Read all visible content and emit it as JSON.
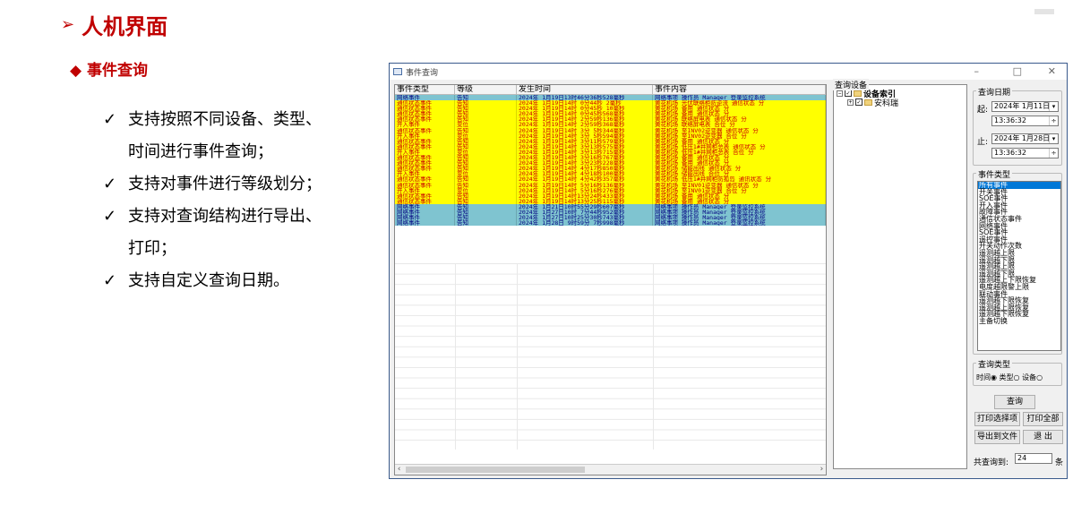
{
  "slide": {
    "title": "人机界面",
    "subtitle": "事件查询",
    "bullets": [
      {
        "check": "✓",
        "lines": [
          "支持按照不同设备、类型、",
          "时间进行事件查询；"
        ]
      },
      {
        "check": "✓",
        "lines": [
          "支持对事件进行等级划分；"
        ]
      },
      {
        "check": "✓",
        "lines": [
          "支持对查询结构进行导出、",
          "打印；"
        ]
      },
      {
        "check": "✓",
        "lines": [
          "支持自定义查询日期。"
        ]
      }
    ]
  },
  "window": {
    "title": "事件查询",
    "minimize": "–",
    "maximize": "□",
    "close": "✕"
  },
  "table": {
    "columns": [
      "事件类型",
      "等级",
      "发生时间",
      "事件内容"
    ],
    "rows": [
      {
        "type": "网络事件",
        "level": "告知",
        "time": "2024年 1月19日13时46分36秒528毫秒",
        "content": "网络事项 操作员 Manager 登录监控系统",
        "color": "c"
      },
      {
        "type": "通信状态事件",
        "level": "告知",
        "time": "2024年 1月19日14时 0分44秒  2毫秒",
        "content": "黄花机场 光伏联络柜防逆流 通信状态 分",
        "color": "y"
      },
      {
        "type": "通信状态事件",
        "level": "告知",
        "time": "2024年 1月19日14时 0分45秒 10毫秒",
        "content": "黄花机场 备用 通信状态 分",
        "color": "y"
      },
      {
        "type": "通信状态事件",
        "level": "告知",
        "time": "2024年 1月19日14时 0分45秒568毫秒",
        "content": "黄花机场 备用 通信状态 分",
        "color": "y"
      },
      {
        "type": "通信状态事件",
        "level": "告知",
        "time": "2024年 1月19日14时 2分59秒136毫秒",
        "content": "黄花机场 联络屏电表 通信状态 分",
        "color": "y"
      },
      {
        "type": "开入事件",
        "level": "变位",
        "time": "2024年 1月19日14时 2分59秒368毫秒",
        "content": "黄花机场 联络屏电表 合位 分",
        "color": "y"
      },
      {
        "type": "通信状态事件",
        "level": "告知",
        "time": "2024年 1月19日14时 3分 5秒344毫秒",
        "content": "黄花机场 至INV02逆变器 通信状态 分",
        "color": "y"
      },
      {
        "type": "开入事件",
        "level": "变位",
        "time": "2024年 1月19日14时 3分 5秒594毫秒",
        "content": "黄花机场 至INV02逆变器 合位 分",
        "color": "y"
      },
      {
        "type": "通信状态事件",
        "level": "告知",
        "time": "2024年 1月19日14时 3分11秒579毫秒",
        "content": "黄花机场 备用 通信状态 分",
        "color": "y"
      },
      {
        "type": "通信状态事件",
        "level": "告知",
        "time": "2024年 1月19日14时 3分13秒575毫秒",
        "content": "黄花机场 低压1#并网柜总表 通信状态 分",
        "color": "y"
      },
      {
        "type": "开入事件",
        "level": "变位",
        "time": "2024年 1月19日14时 3分13秒715毫秒",
        "content": "黄花机场 低压1#并网柜总表 合位 分",
        "color": "y"
      },
      {
        "type": "通信状态事件",
        "level": "告知",
        "time": "2024年 1月19日14时 3分16秒767毫秒",
        "content": "黄花机场 备用 通信状态 分",
        "color": "y"
      },
      {
        "type": "通信状态事件",
        "level": "告知",
        "time": "2024年 1月19日14时 3分23秒228毫秒",
        "content": "黄花机场 备用 通信状态 分",
        "color": "y"
      },
      {
        "type": "通信状态事件",
        "level": "告知",
        "time": "2024年 1月19日14时 4分17秒850毫秒",
        "content": "黄花机场 储能出线 通信状态 分",
        "color": "y"
      },
      {
        "type": "开入事件",
        "level": "变位",
        "time": "2024年 1月19日14时 4分18秒100毫秒",
        "content": "黄花机场 储能出线 合位 分",
        "color": "y"
      },
      {
        "type": "通信状态事件",
        "level": "告知",
        "time": "2024年 1月19日14时 4分42秒357毫秒",
        "content": "黄花机场 低压1#并网柜防孤岛 通讯状态 分",
        "color": "y"
      },
      {
        "type": "通信状态事件",
        "level": "告知",
        "time": "2024年 1月19日14时 5分16秒136毫秒",
        "content": "黄花机场 至INV01逆变器 通信状态 分",
        "color": "y"
      },
      {
        "type": "开入事件",
        "level": "变位",
        "time": "2024年 1月19日14时 5分16秒276毫秒",
        "content": "黄花机场 至INV01逆变器 合位 分",
        "color": "y"
      },
      {
        "type": "通信状态事件",
        "level": "告知",
        "time": "2024年 1月19日14时13分24秒433毫秒",
        "content": "黄花机场 备用 通信状态 分",
        "color": "y"
      },
      {
        "type": "通信状态事件",
        "level": "告知",
        "time": "2024年 1月19日14时13分25秒115毫秒",
        "content": "黄花机场 备用 通信状态 分",
        "color": "y"
      },
      {
        "type": "网络事件",
        "level": "告知",
        "time": "2024年 1月21日10时55分29秒607毫秒",
        "content": "网络事项 操作员 Manager 登录监控系统",
        "color": "c"
      },
      {
        "type": "网络事件",
        "level": "告知",
        "time": "2024年 1月27日10时 7分44秒952毫秒",
        "content": "网络事项 操作员 Manager 登录监控系统",
        "color": "c"
      },
      {
        "type": "网络事件",
        "level": "告知",
        "time": "2024年 1月27日10时25分30秒743毫秒",
        "content": "网络事项 操作员 Manager 登录监控系统",
        "color": "c"
      },
      {
        "type": "网络事件",
        "level": "告知",
        "time": "2024年 1月28日 9时59分 7秒998毫秒",
        "content": "网络事项 操作员 Manager 登录监控系统",
        "color": "c"
      }
    ],
    "scroll_left": "‹",
    "scroll_right": "›"
  },
  "tree": {
    "label": "查询设备",
    "root": "设备索引",
    "child": "安科瑞",
    "expand_root": "−",
    "expand_child": "+",
    "check_mark": "✓"
  },
  "date": {
    "label": "查询日期",
    "start_label": "起:",
    "start_date": "2024年 1月11日",
    "start_time": "13:36:32",
    "end_label": "止:",
    "end_date": "2024年 1月28日",
    "end_time": "13:36:32",
    "dd": "▾",
    "spin": "÷"
  },
  "event_types": {
    "label": "事件类型",
    "items": [
      "所有事件",
      "开关事件",
      "SOE事件",
      "开入事件",
      "故障事件",
      "通信状态事件",
      "网络事件",
      "SOE事件",
      "遥控事件",
      "开关动作次数",
      "遥测越上限",
      "遥测越下限",
      "遥测越上限",
      "遥测越下限",
      "遥测越上下限恢复",
      "电度越限警上限",
      "联动事件",
      "遥测越下限恢复",
      "遥测越上限恢复",
      "遥测越下限恢复",
      "主备切换"
    ]
  },
  "query_type": {
    "label": "查询类型",
    "opt1": "时间",
    "opt2": "类型",
    "opt3": "设备",
    "radio_on": "◉",
    "radio_off": "○"
  },
  "buttons": {
    "query": "查询",
    "print_sel": "打印选择项",
    "print_all": "打印全部",
    "export": "导出到文件",
    "exit": "退 出"
  },
  "footer": {
    "count_label": "共查询到:",
    "count": "24",
    "unit": "条"
  },
  "marks": {
    "arrow": "➢",
    "diamond": "◆"
  }
}
